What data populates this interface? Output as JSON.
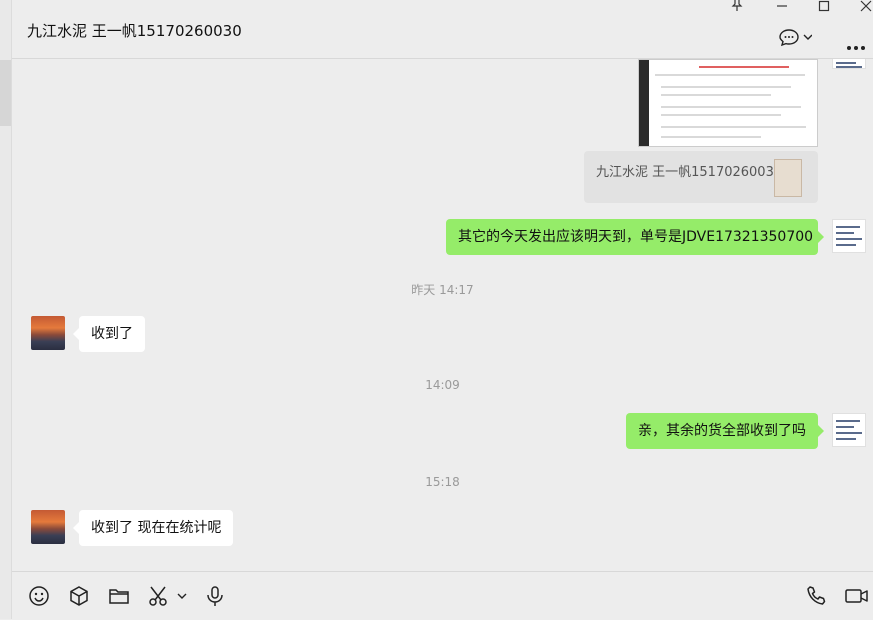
{
  "header": {
    "title": "九江水泥 王一帆15170260030"
  },
  "messages": {
    "quote_text": "九江水泥 王一帆15170260030:",
    "m1": "其它的今天发出应该明天到，单号是JDVE17321350700",
    "ts1": "昨天 14:17",
    "m2": "收到了",
    "ts2": "14:09",
    "m3": "亲，其余的货全部收到了吗",
    "ts3": "15:18",
    "m4": "收到了  现在在统计呢"
  },
  "icons": {
    "pin": "pin-icon",
    "minimize": "minimize-icon",
    "maximize": "maximize-icon",
    "close": "close-icon",
    "chat_info": "chat-bubble-icon",
    "more": "more-icon",
    "emoji": "emoji-icon",
    "favorite": "cube-icon",
    "file": "folder-icon",
    "screenshot": "scissors-icon",
    "voice": "microphone-icon",
    "call": "phone-icon",
    "video": "video-icon"
  },
  "colors": {
    "self_bubble": "#95ec69",
    "other_bubble": "#ffffff",
    "background": "#ededed"
  }
}
